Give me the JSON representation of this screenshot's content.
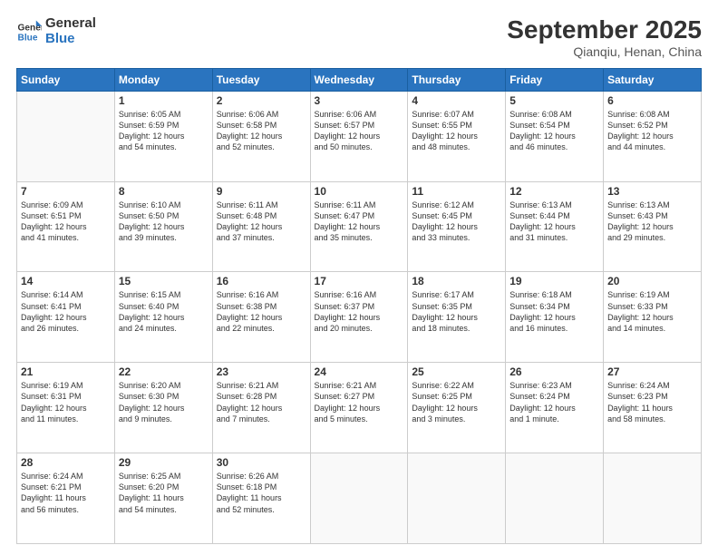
{
  "logo": {
    "line1": "General",
    "line2": "Blue"
  },
  "title": "September 2025",
  "subtitle": "Qianqiu, Henan, China",
  "days_of_week": [
    "Sunday",
    "Monday",
    "Tuesday",
    "Wednesday",
    "Thursday",
    "Friday",
    "Saturday"
  ],
  "weeks": [
    [
      {
        "day": "",
        "info": ""
      },
      {
        "day": "1",
        "info": "Sunrise: 6:05 AM\nSunset: 6:59 PM\nDaylight: 12 hours\nand 54 minutes."
      },
      {
        "day": "2",
        "info": "Sunrise: 6:06 AM\nSunset: 6:58 PM\nDaylight: 12 hours\nand 52 minutes."
      },
      {
        "day": "3",
        "info": "Sunrise: 6:06 AM\nSunset: 6:57 PM\nDaylight: 12 hours\nand 50 minutes."
      },
      {
        "day": "4",
        "info": "Sunrise: 6:07 AM\nSunset: 6:55 PM\nDaylight: 12 hours\nand 48 minutes."
      },
      {
        "day": "5",
        "info": "Sunrise: 6:08 AM\nSunset: 6:54 PM\nDaylight: 12 hours\nand 46 minutes."
      },
      {
        "day": "6",
        "info": "Sunrise: 6:08 AM\nSunset: 6:52 PM\nDaylight: 12 hours\nand 44 minutes."
      }
    ],
    [
      {
        "day": "7",
        "info": "Sunrise: 6:09 AM\nSunset: 6:51 PM\nDaylight: 12 hours\nand 41 minutes."
      },
      {
        "day": "8",
        "info": "Sunrise: 6:10 AM\nSunset: 6:50 PM\nDaylight: 12 hours\nand 39 minutes."
      },
      {
        "day": "9",
        "info": "Sunrise: 6:11 AM\nSunset: 6:48 PM\nDaylight: 12 hours\nand 37 minutes."
      },
      {
        "day": "10",
        "info": "Sunrise: 6:11 AM\nSunset: 6:47 PM\nDaylight: 12 hours\nand 35 minutes."
      },
      {
        "day": "11",
        "info": "Sunrise: 6:12 AM\nSunset: 6:45 PM\nDaylight: 12 hours\nand 33 minutes."
      },
      {
        "day": "12",
        "info": "Sunrise: 6:13 AM\nSunset: 6:44 PM\nDaylight: 12 hours\nand 31 minutes."
      },
      {
        "day": "13",
        "info": "Sunrise: 6:13 AM\nSunset: 6:43 PM\nDaylight: 12 hours\nand 29 minutes."
      }
    ],
    [
      {
        "day": "14",
        "info": "Sunrise: 6:14 AM\nSunset: 6:41 PM\nDaylight: 12 hours\nand 26 minutes."
      },
      {
        "day": "15",
        "info": "Sunrise: 6:15 AM\nSunset: 6:40 PM\nDaylight: 12 hours\nand 24 minutes."
      },
      {
        "day": "16",
        "info": "Sunrise: 6:16 AM\nSunset: 6:38 PM\nDaylight: 12 hours\nand 22 minutes."
      },
      {
        "day": "17",
        "info": "Sunrise: 6:16 AM\nSunset: 6:37 PM\nDaylight: 12 hours\nand 20 minutes."
      },
      {
        "day": "18",
        "info": "Sunrise: 6:17 AM\nSunset: 6:35 PM\nDaylight: 12 hours\nand 18 minutes."
      },
      {
        "day": "19",
        "info": "Sunrise: 6:18 AM\nSunset: 6:34 PM\nDaylight: 12 hours\nand 16 minutes."
      },
      {
        "day": "20",
        "info": "Sunrise: 6:19 AM\nSunset: 6:33 PM\nDaylight: 12 hours\nand 14 minutes."
      }
    ],
    [
      {
        "day": "21",
        "info": "Sunrise: 6:19 AM\nSunset: 6:31 PM\nDaylight: 12 hours\nand 11 minutes."
      },
      {
        "day": "22",
        "info": "Sunrise: 6:20 AM\nSunset: 6:30 PM\nDaylight: 12 hours\nand 9 minutes."
      },
      {
        "day": "23",
        "info": "Sunrise: 6:21 AM\nSunset: 6:28 PM\nDaylight: 12 hours\nand 7 minutes."
      },
      {
        "day": "24",
        "info": "Sunrise: 6:21 AM\nSunset: 6:27 PM\nDaylight: 12 hours\nand 5 minutes."
      },
      {
        "day": "25",
        "info": "Sunrise: 6:22 AM\nSunset: 6:25 PM\nDaylight: 12 hours\nand 3 minutes."
      },
      {
        "day": "26",
        "info": "Sunrise: 6:23 AM\nSunset: 6:24 PM\nDaylight: 12 hours\nand 1 minute."
      },
      {
        "day": "27",
        "info": "Sunrise: 6:24 AM\nSunset: 6:23 PM\nDaylight: 11 hours\nand 58 minutes."
      }
    ],
    [
      {
        "day": "28",
        "info": "Sunrise: 6:24 AM\nSunset: 6:21 PM\nDaylight: 11 hours\nand 56 minutes."
      },
      {
        "day": "29",
        "info": "Sunrise: 6:25 AM\nSunset: 6:20 PM\nDaylight: 11 hours\nand 54 minutes."
      },
      {
        "day": "30",
        "info": "Sunrise: 6:26 AM\nSunset: 6:18 PM\nDaylight: 11 hours\nand 52 minutes."
      },
      {
        "day": "",
        "info": ""
      },
      {
        "day": "",
        "info": ""
      },
      {
        "day": "",
        "info": ""
      },
      {
        "day": "",
        "info": ""
      }
    ]
  ]
}
